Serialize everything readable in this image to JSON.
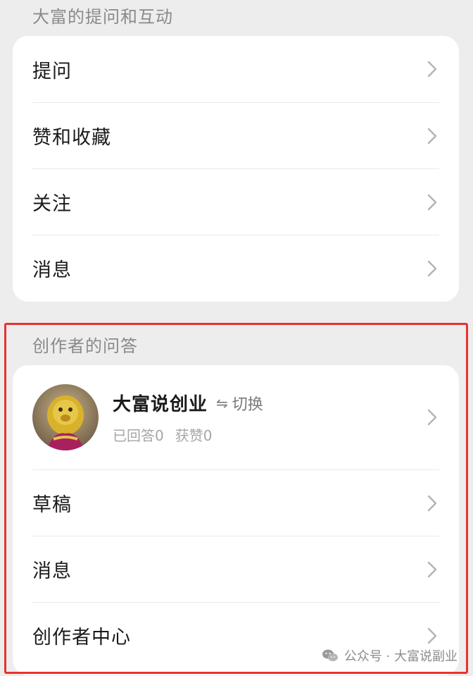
{
  "section1": {
    "title": "大富的提问和互动",
    "items": [
      {
        "label": "提问"
      },
      {
        "label": "赞和收藏"
      },
      {
        "label": "关注"
      },
      {
        "label": "消息"
      }
    ]
  },
  "section2": {
    "title": "创作者的问答",
    "profile": {
      "name": "大富说创业",
      "switch_label": "切换",
      "switch_icon": "swap-arrows-icon",
      "answered": "已回答0",
      "likes": "获赞0"
    },
    "items": [
      {
        "label": "草稿"
      },
      {
        "label": "消息"
      },
      {
        "label": "创作者中心"
      }
    ]
  },
  "watermark": {
    "text": "公众号 · 大富说副业"
  },
  "colors": {
    "background": "#ededed",
    "card": "#ffffff",
    "highlight": "#e8322e",
    "muted": "#8a8a8a"
  }
}
